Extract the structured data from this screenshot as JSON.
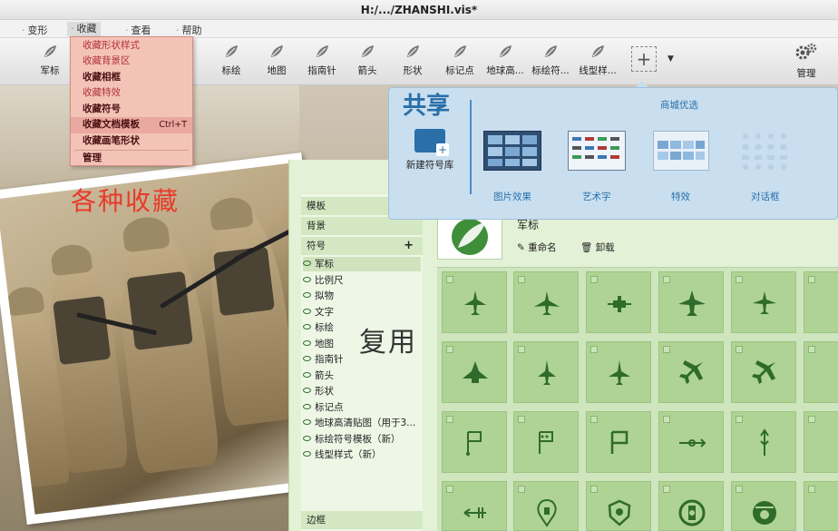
{
  "window": {
    "title": "H:/.../ZHANSHI.vis*"
  },
  "menubar": {
    "items": [
      {
        "label": "变形"
      },
      {
        "label": "收藏"
      },
      {
        "label": "查看"
      },
      {
        "label": "帮助"
      }
    ]
  },
  "collect_menu": {
    "items": [
      {
        "label": "收藏形状样式"
      },
      {
        "label": "收藏背景区"
      },
      {
        "label": "收藏相框"
      },
      {
        "label": "收藏特效"
      },
      {
        "label": "收藏符号"
      },
      {
        "label": "收藏文档模板",
        "shortcut": "Ctrl+T"
      },
      {
        "label": "收藏画笔形状"
      },
      {
        "label": "管理"
      }
    ]
  },
  "toolbar": {
    "tools": [
      {
        "label": "军标"
      },
      {
        "label": "标绘"
      },
      {
        "label": "地图"
      },
      {
        "label": "指南针"
      },
      {
        "label": "箭头"
      },
      {
        "label": "形状"
      },
      {
        "label": "标记点"
      },
      {
        "label": "地球高..."
      },
      {
        "label": "标绘符..."
      },
      {
        "label": "线型样..."
      }
    ],
    "add_label": "+",
    "manage_label": "管理"
  },
  "caption_collect": "各种收藏",
  "caption_reuse": "复用",
  "share": {
    "title": "共享",
    "subtitle": "商城优选",
    "new_label": "新建符号库",
    "items": [
      {
        "label": "图片效果"
      },
      {
        "label": "艺术字"
      },
      {
        "label": "特效"
      },
      {
        "label": "对话框"
      }
    ]
  },
  "library": {
    "sections": [
      {
        "label": "模板"
      },
      {
        "label": "背景"
      },
      {
        "label": "符号"
      },
      {
        "label": "边框"
      }
    ],
    "tree": [
      {
        "label": "军标"
      },
      {
        "label": "比例尺"
      },
      {
        "label": "拟物"
      },
      {
        "label": "文字"
      },
      {
        "label": "标绘"
      },
      {
        "label": "地图"
      },
      {
        "label": "指南针"
      },
      {
        "label": "箭头"
      },
      {
        "label": "形状"
      },
      {
        "label": "标记点"
      },
      {
        "label": "地球高清贴图（用于3..."
      },
      {
        "label": "标绘符号模板（新）"
      },
      {
        "label": "线型样式（新）"
      }
    ],
    "current": {
      "name": "军标",
      "rename_label": "重命名",
      "unload_label": "卸载"
    }
  },
  "colors": {
    "accent_red": "#e83a2a",
    "share_blue": "#2a6fa8",
    "lib_green": "#aed394",
    "icon_green": "#2f6b2a"
  }
}
